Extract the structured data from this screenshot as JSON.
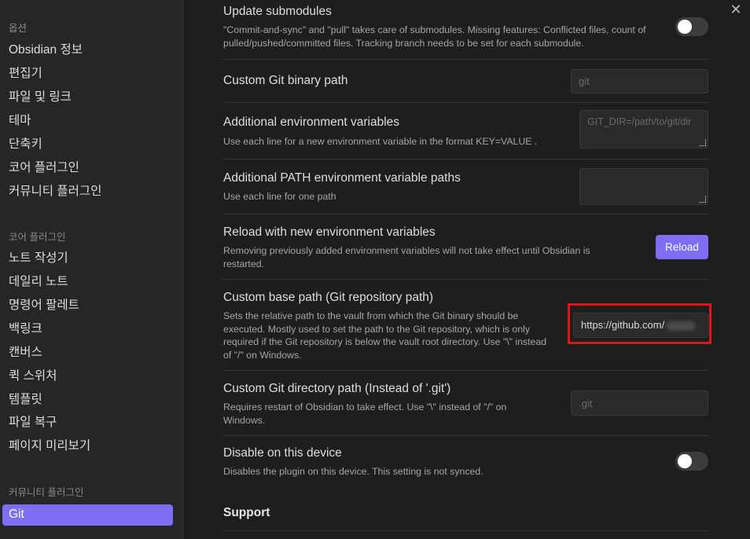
{
  "sidebar": {
    "options_heading": "옵션",
    "options": [
      "Obsidian 정보",
      "편집기",
      "파일 및 링크",
      "테마",
      "단축키",
      "코어 플러그인",
      "커뮤니티 플러그인"
    ],
    "core_heading": "코어 플러그인",
    "core": [
      "노트 작성기",
      "데일리 노트",
      "명령어 팔레트",
      "백링크",
      "캔버스",
      "퀵 스위처",
      "템플릿",
      "파일 복구",
      "페이지 미리보기"
    ],
    "community_heading": "커뮤니티 플러그인",
    "community": [
      "Git"
    ]
  },
  "main": {
    "close_symbol": "✕",
    "settings": {
      "update_submodules": {
        "title": "Update submodules",
        "desc": "\"Commit-and-sync\" and \"pull\" takes care of submodules. Missing features: Conflicted files, count of pulled/pushed/committed files. Tracking branch needs to be set for each submodule.",
        "toggle": "off"
      },
      "git_binary": {
        "title": "Custom Git binary path",
        "placeholder": "git"
      },
      "env_vars": {
        "title": "Additional environment variables",
        "desc": "Use each line for a new environment variable in the format KEY=VALUE .",
        "placeholder": "GIT_DIR=/path/to/git/dir"
      },
      "path_vars": {
        "title": "Additional PATH environment variable paths",
        "desc": "Use each line for one path",
        "placeholder": ""
      },
      "reload_env": {
        "title": "Reload with new environment variables",
        "desc": "Removing previously added environment variables will not take effect until Obsidian is restarted.",
        "button": "Reload"
      },
      "base_path": {
        "title": "Custom base path (Git repository path)",
        "desc": "Sets the relative path to the vault from which the Git binary should be executed. Mostly used to set the path to the Git repository, which is only required if the Git repository is below the vault root directory. Use \"\\\" instead of \"/\" on Windows.",
        "value": "https://github.com/"
      },
      "git_dir": {
        "title": "Custom Git directory path (Instead of '.git')",
        "desc": "Requires restart of Obsidian to take effect. Use \"\\\" instead of \"/\" on Windows.",
        "placeholder": ".git"
      },
      "disable_device": {
        "title": "Disable on this device",
        "desc": "Disables the plugin on this device. This setting is not synced.",
        "toggle": "off"
      }
    },
    "support_heading": "Support"
  },
  "colors": {
    "accent": "#7f6df2",
    "highlight": "#e0141b"
  }
}
